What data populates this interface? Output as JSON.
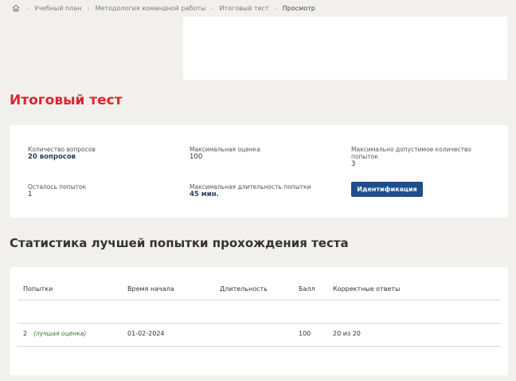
{
  "breadcrumb": {
    "items": [
      "Учебный план",
      "Методология командной работы",
      "Итоговый тест"
    ],
    "current": "Просмотр"
  },
  "page": {
    "title": "Итоговый тест"
  },
  "info": {
    "questions_label": "Количество вопросов",
    "questions_value": "20 вопросов",
    "max_score_label": "Максимальная оценка",
    "max_score_value": "100",
    "max_attempts_label": "Максимально допустимое количество попыток",
    "max_attempts_value": "3",
    "remaining_label": "Осталось попыток",
    "remaining_value": "1",
    "max_duration_label": "Максимальная длительность попытки",
    "max_duration_value": "45 мин.",
    "ident_button": "Идентификация"
  },
  "stats": {
    "title": "Статистика лучшей попытки прохождения теста",
    "headers": {
      "attempts": "Попытки",
      "start_time": "Время начала",
      "duration": "Длительность",
      "score": "Балл",
      "correct": "Корректные ответы"
    },
    "rows": [
      {
        "attempt": "2",
        "best_note": "(лучшая оценка)",
        "start_time": "01-02-2024",
        "duration": "",
        "score": "100",
        "correct": "20 из 20"
      }
    ]
  }
}
